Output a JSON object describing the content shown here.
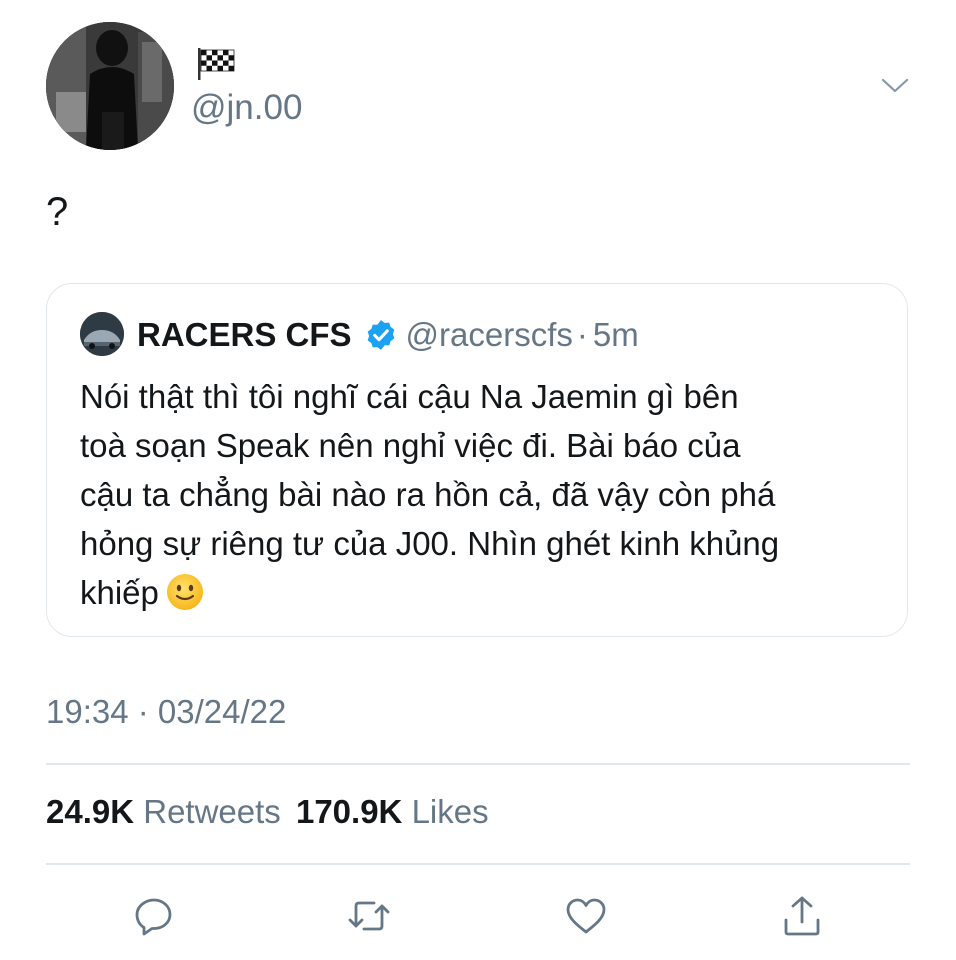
{
  "tweet": {
    "flag_emoji": "🏁",
    "handle": "@jn.00",
    "text": "?",
    "timestamp": "19:34 · 03/24/22"
  },
  "quoted_tweet": {
    "name": "RACERS CFS",
    "handle": "@racerscfs",
    "separator": "·",
    "time": "5m",
    "verified": true,
    "lines": [
      "Nói thật thì tôi nghĩ cái cậu Na Jaemin gì bên",
      "toà soạn Speak nên nghỉ việc đi. Bài báo của",
      "cậu ta chẳng bài nào ra hồn cả, đã vậy còn phá",
      "hỏng sự riêng tư của J00. Nhìn ghét kinh khủng",
      "khiếp"
    ],
    "end_emoji": "slightly-smiling-face"
  },
  "stats": {
    "retweets_count": "24.9K",
    "retweets_label": "Retweets",
    "likes_count": "170.9K",
    "likes_label": "Likes"
  },
  "actions": [
    "reply-icon",
    "retweet-icon",
    "like-icon",
    "share-icon"
  ],
  "colors": {
    "text": "#14171a",
    "secondary": "#657786",
    "border": "#e1e8ed",
    "verified": "#1da1f2"
  }
}
